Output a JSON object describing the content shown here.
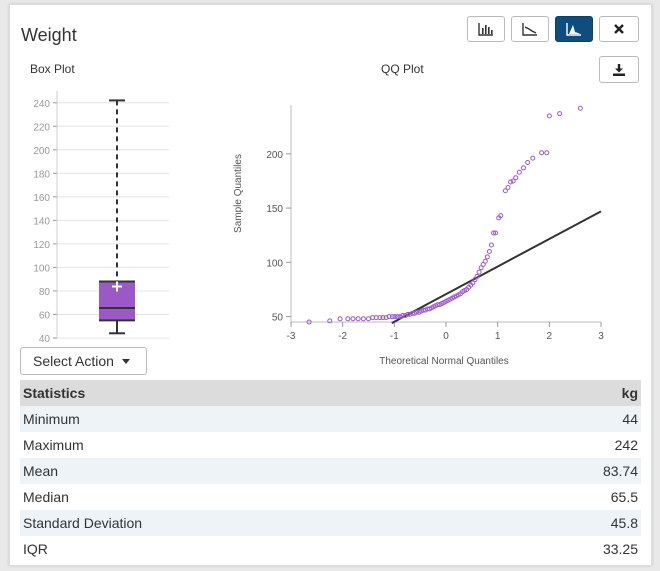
{
  "header": {
    "title": "Weight"
  },
  "toolbar": {
    "buttons": [
      {
        "name": "histogram-view-button",
        "icon": "bar-chart-icon",
        "active": false
      },
      {
        "name": "line-view-button",
        "icon": "line-chart-icon",
        "active": false
      },
      {
        "name": "area-view-button",
        "icon": "area-chart-icon",
        "active": true
      },
      {
        "name": "close-button",
        "icon": "close-icon",
        "active": false
      }
    ],
    "download_icon": "download-icon"
  },
  "box_plot": {
    "label": "Box Plot"
  },
  "qq_plot": {
    "label": "QQ Plot"
  },
  "chart_data": [
    {
      "type": "box",
      "title": "Box Plot",
      "ylim": [
        40,
        250
      ],
      "yticks": [
        40,
        60,
        80,
        100,
        120,
        140,
        160,
        180,
        200,
        220,
        240
      ],
      "min": 44,
      "q1": 55,
      "median": 65.5,
      "mean": 83.74,
      "q3": 88,
      "max": 242,
      "color": "#9b59c8"
    },
    {
      "type": "scatter",
      "title": "QQ Plot",
      "xlabel": "Theoretical Normal Quantiles",
      "ylabel": "Sample Quantiles",
      "xlim": [
        -3,
        3
      ],
      "ylim": [
        45,
        245
      ],
      "xticks": [
        -3,
        -2,
        -1,
        0,
        1,
        2,
        3
      ],
      "yticks": [
        50,
        100,
        150,
        200
      ],
      "point_color": "#9b59c8",
      "line_color": "#333333",
      "ref_line": {
        "x": [
          -1.05,
          3
        ],
        "y": [
          44,
          147
        ]
      },
      "points": [
        [
          -2.65,
          45
        ],
        [
          -2.25,
          46
        ],
        [
          -2.05,
          48
        ],
        [
          -1.9,
          48
        ],
        [
          -1.8,
          48
        ],
        [
          -1.7,
          48
        ],
        [
          -1.6,
          48
        ],
        [
          -1.5,
          48
        ],
        [
          -1.42,
          49
        ],
        [
          -1.35,
          49
        ],
        [
          -1.28,
          49
        ],
        [
          -1.22,
          49
        ],
        [
          -1.16,
          49
        ],
        [
          -1.1,
          50
        ],
        [
          -1.04,
          50
        ],
        [
          -0.99,
          50
        ],
        [
          -0.94,
          50
        ],
        [
          -0.89,
          50
        ],
        [
          -0.84,
          51
        ],
        [
          -0.79,
          51
        ],
        [
          -0.74,
          52
        ],
        [
          -0.7,
          52
        ],
        [
          -0.65,
          53
        ],
        [
          -0.61,
          53
        ],
        [
          -0.57,
          54
        ],
        [
          -0.52,
          54
        ],
        [
          -0.48,
          55
        ],
        [
          -0.44,
          56
        ],
        [
          -0.4,
          56
        ],
        [
          -0.36,
          57
        ],
        [
          -0.32,
          57
        ],
        [
          -0.28,
          58
        ],
        [
          -0.24,
          59
        ],
        [
          -0.2,
          60
        ],
        [
          -0.16,
          61
        ],
        [
          -0.12,
          61
        ],
        [
          -0.08,
          62
        ],
        [
          -0.04,
          63
        ],
        [
          0.0,
          64
        ],
        [
          0.04,
          65
        ],
        [
          0.08,
          66
        ],
        [
          0.12,
          67
        ],
        [
          0.16,
          68
        ],
        [
          0.2,
          69
        ],
        [
          0.24,
          70
        ],
        [
          0.28,
          71
        ],
        [
          0.32,
          73
        ],
        [
          0.36,
          74
        ],
        [
          0.4,
          75
        ],
        [
          0.44,
          77
        ],
        [
          0.48,
          79
        ],
        [
          0.52,
          81
        ],
        [
          0.56,
          84
        ],
        [
          0.6,
          87
        ],
        [
          0.64,
          91
        ],
        [
          0.68,
          95
        ],
        [
          0.72,
          98
        ],
        [
          0.76,
          101
        ],
        [
          0.8,
          105
        ],
        [
          0.84,
          110
        ],
        [
          0.88,
          116
        ],
        [
          0.92,
          127
        ],
        [
          0.96,
          127
        ],
        [
          1.02,
          141
        ],
        [
          1.06,
          143
        ],
        [
          1.15,
          166
        ],
        [
          1.2,
          169
        ],
        [
          1.25,
          174
        ],
        [
          1.3,
          175
        ],
        [
          1.35,
          178
        ],
        [
          1.42,
          183
        ],
        [
          1.5,
          187
        ],
        [
          1.58,
          192
        ],
        [
          1.68,
          196
        ],
        [
          1.85,
          201
        ],
        [
          1.95,
          201
        ],
        [
          2.0,
          235
        ],
        [
          2.2,
          237
        ],
        [
          2.6,
          242
        ]
      ]
    }
  ],
  "action": {
    "label": "Select Action"
  },
  "stats_table": {
    "header": [
      "Statistics",
      "kg"
    ],
    "rows": [
      [
        "Minimum",
        "44"
      ],
      [
        "Maximum",
        "242"
      ],
      [
        "Mean",
        "83.74"
      ],
      [
        "Median",
        "65.5"
      ],
      [
        "Standard Deviation",
        "45.8"
      ],
      [
        "IQR",
        "33.25"
      ]
    ]
  }
}
